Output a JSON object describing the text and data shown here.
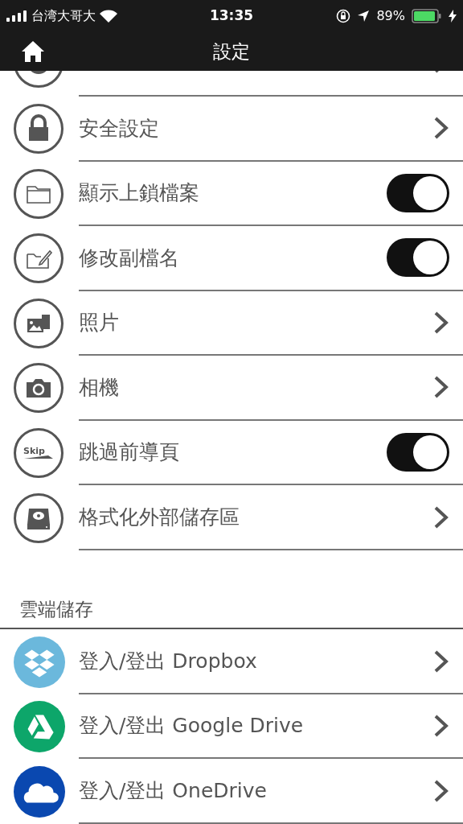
{
  "status_bar": {
    "carrier": "台湾大哥大",
    "time": "13:35",
    "battery": "89%"
  },
  "header": {
    "title": "設定"
  },
  "settings": [
    {
      "kind": "link",
      "label": "安全設定"
    },
    {
      "kind": "toggle",
      "label": "顯示上鎖檔案",
      "on": true
    },
    {
      "kind": "toggle",
      "label": "修改副檔名",
      "on": true
    },
    {
      "kind": "link",
      "label": "照片"
    },
    {
      "kind": "link",
      "label": "相機"
    },
    {
      "kind": "toggle",
      "label": "跳過前導頁",
      "on": true,
      "icon_text": "Skip"
    },
    {
      "kind": "link",
      "label": "格式化外部儲存區"
    }
  ],
  "cloud": {
    "title": "雲端儲存",
    "items": [
      {
        "label": "登入/登出 Dropbox",
        "color": "#6bb8dc"
      },
      {
        "label": "登入/登出 Google Drive",
        "color": "#0da66a"
      },
      {
        "label": "登入/登出 OneDrive",
        "color": "#0a48b0"
      }
    ]
  }
}
